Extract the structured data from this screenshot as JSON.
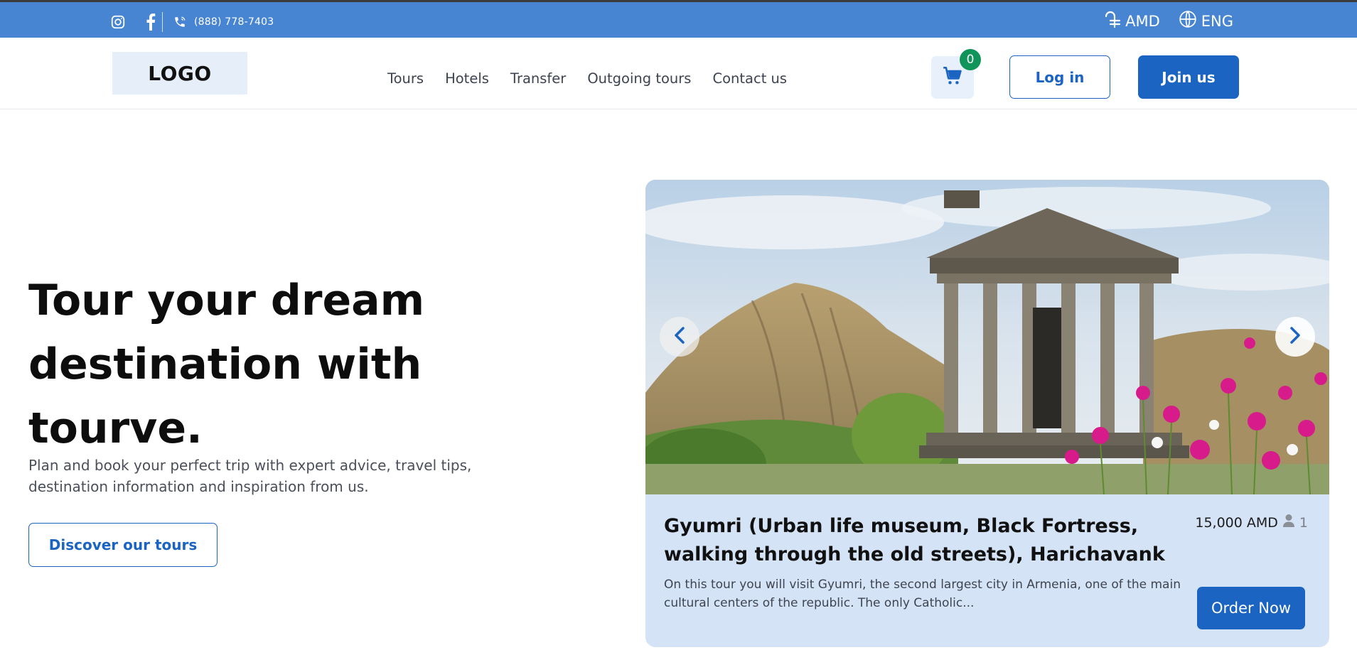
{
  "topbar": {
    "icons": {
      "instagram": "instagram-icon",
      "facebook": "facebook-icon",
      "phone": "phone-icon",
      "currency": "dram-currency-icon",
      "language": "globe-icon"
    },
    "phone": "(888) 778-7403",
    "currency": "AMD",
    "language": "ENG",
    "bg_color": "#4785d2"
  },
  "header": {
    "logo": "LOGO",
    "nav": [
      "Tours",
      "Hotels",
      "Transfer",
      "Outgoing tours",
      "Contact us"
    ],
    "cart_count": "0",
    "login_label": "Log in",
    "join_label": "Join us",
    "accent_color": "#1b64c2",
    "badge_color": "#11945a"
  },
  "hero": {
    "title_lines": [
      "Tour your dream",
      "destination with",
      "tourve."
    ],
    "subtitle": "Plan and book your perfect trip with expert advice, travel tips, destination information and inspiration from us.",
    "cta": "Discover our tours"
  },
  "featured_tour": {
    "title": "Gyumri (Urban life museum, Black Fortress, walking through the old streets), Harichavank",
    "description": "On this tour you will visit Gyumri, the second largest city in Armenia, one of the main cultural centers of the republic. The only Catholic...",
    "price": "15,000 AMD",
    "persons": "1",
    "order_label": "Order Now",
    "card_bg": "#d4e3f6"
  }
}
